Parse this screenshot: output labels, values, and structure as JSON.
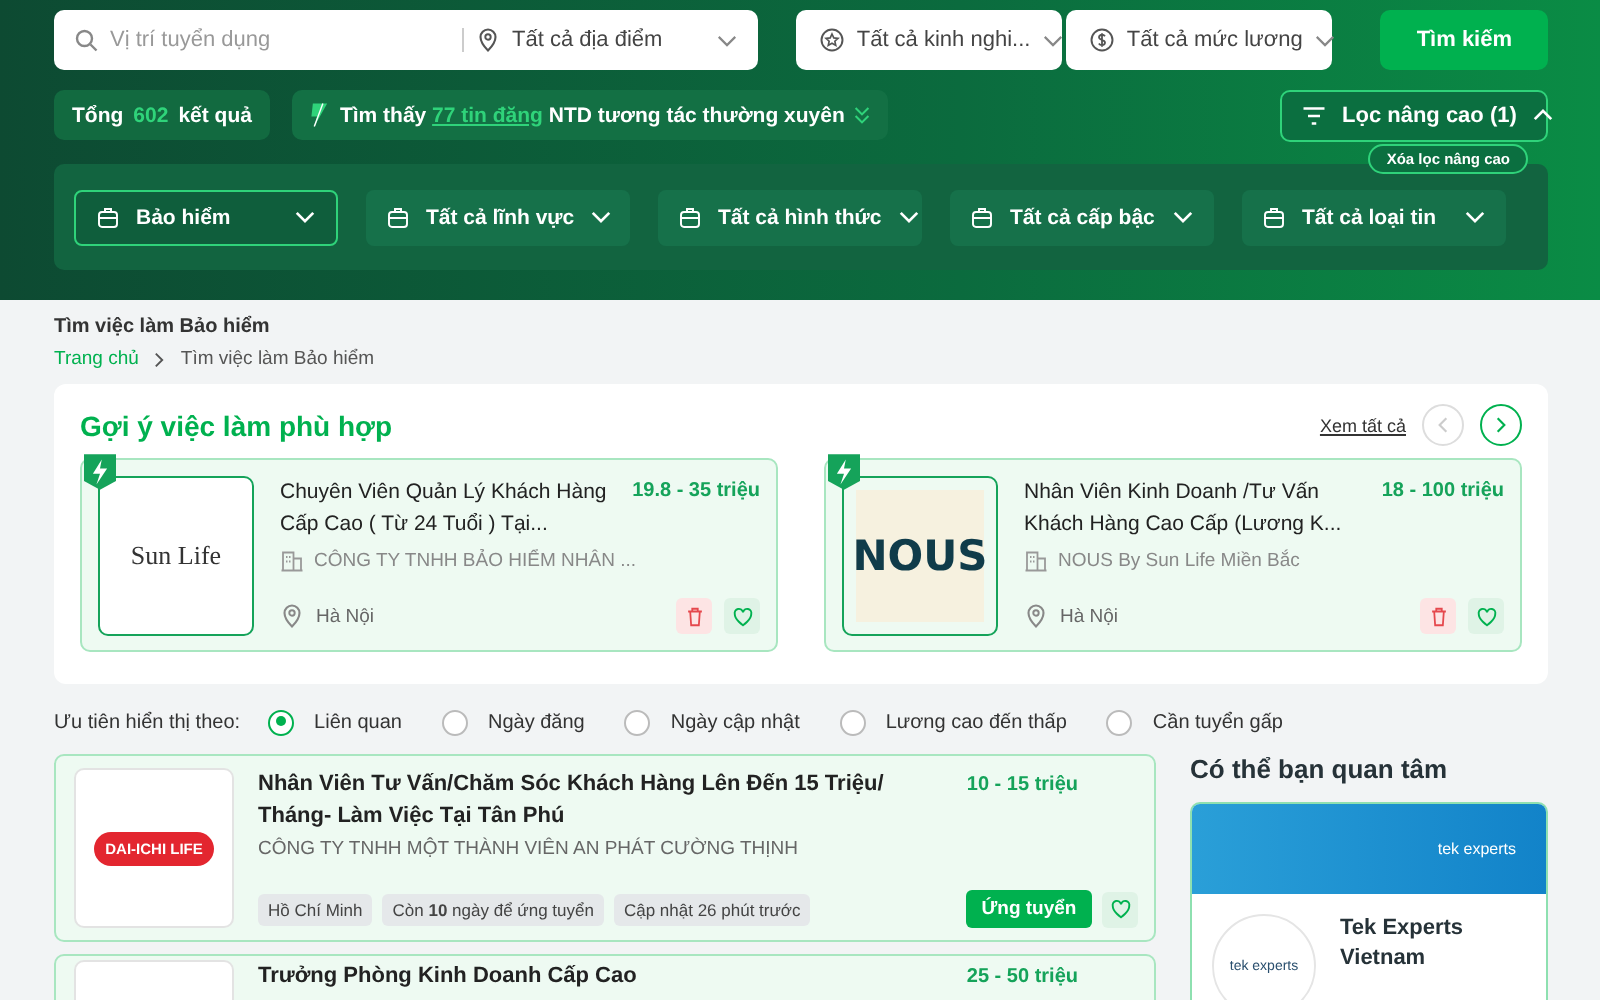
{
  "search": {
    "position_placeholder": "Vị trí tuyển dụng",
    "location": "Tất cả địa điểm",
    "experience": "Tất cả kinh nghi...",
    "salary": "Tất cả mức lương",
    "button": "Tìm kiếm"
  },
  "summary": {
    "total_label": "Tổng",
    "total": "602",
    "total_suffix": "kết quả",
    "found_prefix": "Tìm thấy",
    "found_link": "77 tin đăng",
    "found_suffix": "NTD tương tác thường xuyên"
  },
  "advanced_filter": {
    "label": "Lọc nâng cao (1)",
    "expanded": true,
    "clear_label": "Xóa lọc nâng cao"
  },
  "filters": [
    {
      "label": "Bảo hiểm",
      "selected": true
    },
    {
      "label": "Tất cả lĩnh vực",
      "selected": false
    },
    {
      "label": "Tất cả hình thức",
      "selected": false
    },
    {
      "label": "Tất cả cấp bậc",
      "selected": false
    },
    {
      "label": "Tất cả loại tin",
      "selected": false
    }
  ],
  "page_title": "Tìm việc làm Bảo hiểm",
  "breadcrumb": [
    "Trang chủ",
    "Tìm việc làm Bảo hiểm"
  ],
  "suggestions": {
    "title": "Gợi ý việc làm phù hợp",
    "see_all": "Xem tất cả",
    "jobs": [
      {
        "title": "Chuyên Viên Quản Lý Khách Hàng Cấp Cao ( Từ 24 Tuổi ) Tại...",
        "salary": "19.8 - 35 triệu",
        "company": "CÔNG TY TNHH BẢO HIỂM NHÂN ...",
        "location": "Hà Nội",
        "logo": "Sun Life",
        "kind": "sunlife"
      },
      {
        "title": "Nhân Viên Kinh Doanh /Tư Vấn Khách Hàng Cao Cấp (Lương K...",
        "salary": "18 - 100 triệu",
        "company": "NOUS By Sun Life Miền Bắc",
        "location": "Hà Nội",
        "logo": "NOUS",
        "kind": "nous"
      }
    ]
  },
  "sort": {
    "label": "Ưu tiên hiển thị theo:",
    "options": [
      {
        "label": "Liên quan",
        "selected": true
      },
      {
        "label": "Ngày đăng",
        "selected": false
      },
      {
        "label": "Ngày cập nhật",
        "selected": false
      },
      {
        "label": "Lương cao đến thấp",
        "selected": false
      },
      {
        "label": "Cần tuyển gấp",
        "selected": false
      }
    ]
  },
  "jobs": [
    {
      "title": "Nhân Viên Tư Vấn/Chăm Sóc Khách Hàng Lên Đến 15 Triệu/ Tháng- Làm Việc Tại Tân Phú",
      "salary": "10 - 15 triệu",
      "company": "CÔNG TY TNHH MỘT THÀNH VIÊN AN PHÁT CƯỜNG THỊNH",
      "logo": "DAI-ICHI LIFE",
      "tags": [
        "Hồ Chí Minh",
        "Còn **10** ngày để ứng tuyển",
        "Cập nhật 26 phút trước"
      ],
      "apply": "Ứng tuyển"
    },
    {
      "title": "Trưởng Phòng Kinh Doanh Cấp Cao",
      "salary": "25 - 50 triệu"
    }
  ],
  "sidebar": {
    "title": "Có thể bạn quan tâm",
    "banner_logo": "tek experts",
    "company_logo": "tek experts",
    "company": "Tek Experts Vietnam"
  }
}
